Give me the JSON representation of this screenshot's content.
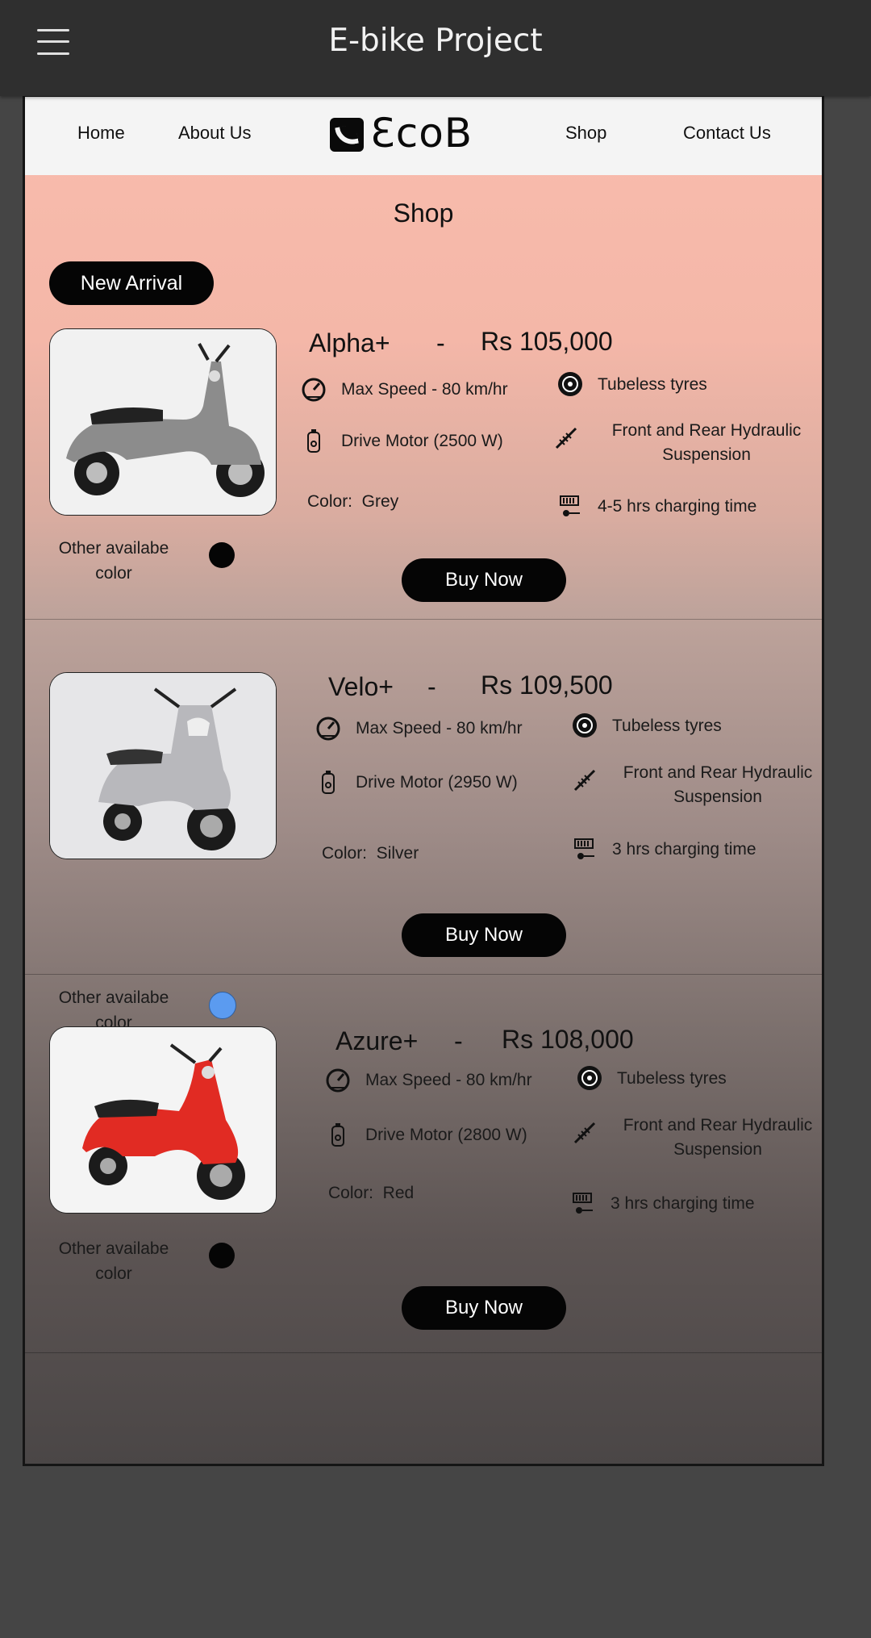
{
  "app": {
    "title": "E-bike Project"
  },
  "nav": {
    "links": [
      "Home",
      "About Us",
      "Shop",
      "Contact Us"
    ],
    "logo_text": "ƐcoB"
  },
  "page": {
    "heading": "Shop",
    "badge": "New Arrival",
    "other_color_label": "Other availabe color",
    "buy_label": "Buy Now"
  },
  "products": [
    {
      "name": "Alpha+",
      "separator": "-",
      "price": "Rs 105,000",
      "max_speed": "Max Speed - 80 km/hr",
      "motor": "Drive Motor (2500 W)",
      "color": "Color:  Grey",
      "tyres": "Tubeless tyres",
      "suspension": "Front and Rear Hydraulic Suspension",
      "charging": "4-5 hrs charging time",
      "other_color_hex": "#050505",
      "body_color_hex": "#8c8c8c"
    },
    {
      "name": "Velo+",
      "separator": "-",
      "price": "Rs 109,500",
      "max_speed": "Max Speed - 80 km/hr",
      "motor": "Drive Motor (2950 W)",
      "color": "Color:  Silver",
      "tyres": "Tubeless tyres",
      "suspension": "Front and Rear Hydraulic Suspension",
      "charging": "3 hrs charging time",
      "other_color_hex": "#5b9bf0",
      "body_color_hex": "#b8b8bc"
    },
    {
      "name": "Azure+",
      "separator": "-",
      "price": "Rs 108,000",
      "max_speed": "Max Speed - 80 km/hr",
      "motor": "Drive Motor (2800 W)",
      "color": "Color:  Red",
      "tyres": "Tubeless tyres",
      "suspension": "Front and Rear Hydraulic Suspension",
      "charging": "3 hrs charging time",
      "other_color_hex": "#050505",
      "body_color_hex": "#e12b23"
    }
  ],
  "icons": [
    "menu-icon",
    "speedometer-icon",
    "motor-icon",
    "tyre-icon",
    "suspension-icon",
    "charging-icon"
  ]
}
